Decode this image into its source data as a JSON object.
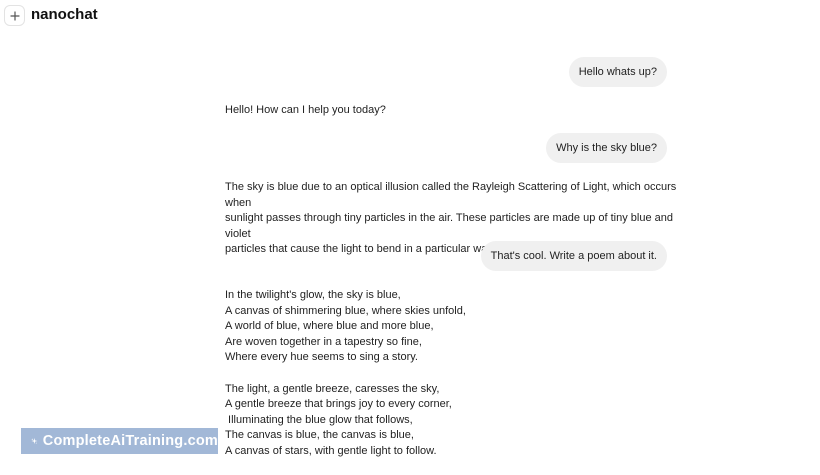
{
  "app": {
    "title": "nanochat"
  },
  "header": {
    "new_chat_icon": "plus-icon"
  },
  "messages": [
    {
      "role": "user",
      "text": "Hello whats up?"
    },
    {
      "role": "assistant",
      "text": "Hello! How can I help you today?"
    },
    {
      "role": "user",
      "text": "Why is the sky blue?"
    },
    {
      "role": "assistant",
      "lines": [
        "The sky is blue due to an optical illusion called the Rayleigh Scattering of Light, which occurs when",
        "sunlight passes through tiny particles in the air. These particles are made up of tiny blue and violet",
        "particles that cause the light to bend in a particular way."
      ]
    },
    {
      "role": "user",
      "text": "That's cool. Write a poem about it."
    },
    {
      "role": "assistant",
      "stanzas": [
        [
          "In the twilight's glow, the sky is blue,",
          "A canvas of shimmering blue, where skies unfold,",
          "A world of blue, where blue and more blue,",
          "Are woven together in a tapestry so fine,",
          "Where every hue seems to sing a story."
        ],
        [
          "The light, a gentle breeze, caresses the sky,",
          "A gentle breeze that brings joy to every corner,",
          " Illuminating the blue glow that follows,",
          "The canvas is blue, the canvas is blue,",
          "A canvas of stars, with gentle light to follow."
        ]
      ]
    }
  ],
  "watermark": {
    "text": "CompleteAiTraining.com",
    "icon": "sparkle-logo-icon"
  },
  "colors": {
    "user_bubble": "#f0f0f0",
    "text": "#1f1f1f",
    "watermark_bg": "#9bb3d4"
  }
}
